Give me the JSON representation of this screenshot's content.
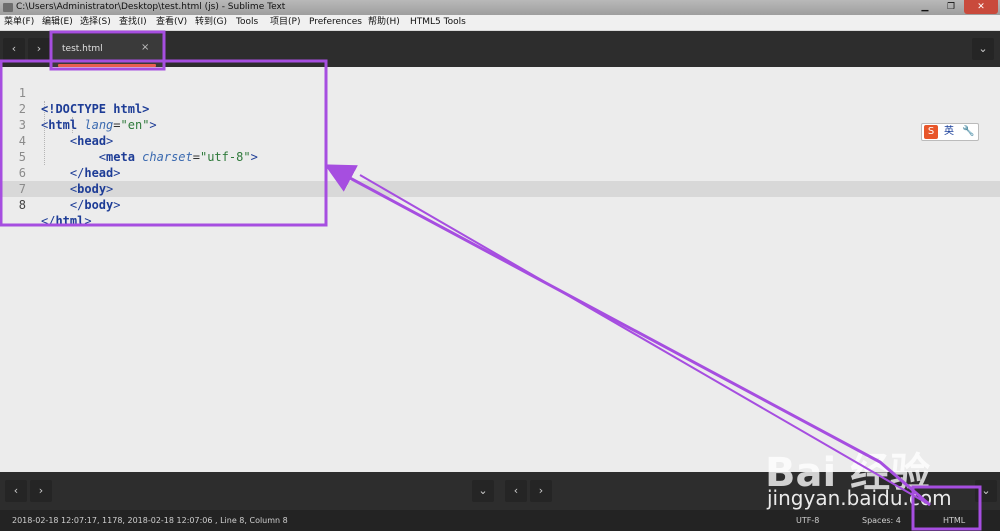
{
  "window": {
    "title": "C:\\Users\\Administrator\\Desktop\\test.html (js) - Sublime Text",
    "controls": {
      "minimize": "▁",
      "maximize": "❐",
      "close": "✕"
    }
  },
  "menu": [
    "菜单(F)",
    "编辑(E)",
    "选择(S)",
    "查找(I)",
    "查看(V)",
    "转到(G)",
    "Tools",
    "项目(P)",
    "Preferences",
    "帮助(H)",
    "HTML5 Tools"
  ],
  "tabbar": {
    "prev_icon": "‹",
    "next_icon": "›",
    "dropdown_icon": "⌄",
    "tab": {
      "label": "test.html",
      "close_icon": "×"
    }
  },
  "editor": {
    "current_line": 8,
    "lines": [
      {
        "n": "1"
      },
      {
        "n": "2"
      },
      {
        "n": "3"
      },
      {
        "n": "4"
      },
      {
        "n": "5"
      },
      {
        "n": "6"
      },
      {
        "n": "7"
      },
      {
        "n": "8"
      }
    ],
    "tokens": {
      "doctype": "<!DOCTYPE html>",
      "open": "<",
      "close": ">",
      "slash_open": "</",
      "eq": "=",
      "html": "html",
      "head": "head",
      "body": "body",
      "meta": "meta",
      "lang_attr": "lang",
      "lang_val": "\"en\"",
      "charset_attr": "charset",
      "charset_val": "\"utf-8\""
    }
  },
  "ime": {
    "logo": "S",
    "mode": "英",
    "tool_icon": "wrench-icon",
    "tool": "🔧"
  },
  "bottom_panel": {
    "left_prev": "‹",
    "left_next": "›",
    "center_down": "⌄",
    "center_prev": "‹",
    "center_next": "›",
    "right_down": "⌄"
  },
  "status": {
    "left": "2018-02-18 12:07:17, 1178, 2018-02-18 12:07:06 , Line 8, Column 8",
    "encoding": "UTF-8",
    "indent": "Spaces: 4",
    "syntax": "HTML"
  },
  "watermark": {
    "brand": "Bai 经验",
    "url": "jingyan.baidu.com"
  },
  "colors": {
    "annotation": "#a64ee0",
    "tab_underline": "#ea5e54",
    "tag": "#1d3c96",
    "attr": "#3b6ab0",
    "string": "#2f7a3b"
  }
}
